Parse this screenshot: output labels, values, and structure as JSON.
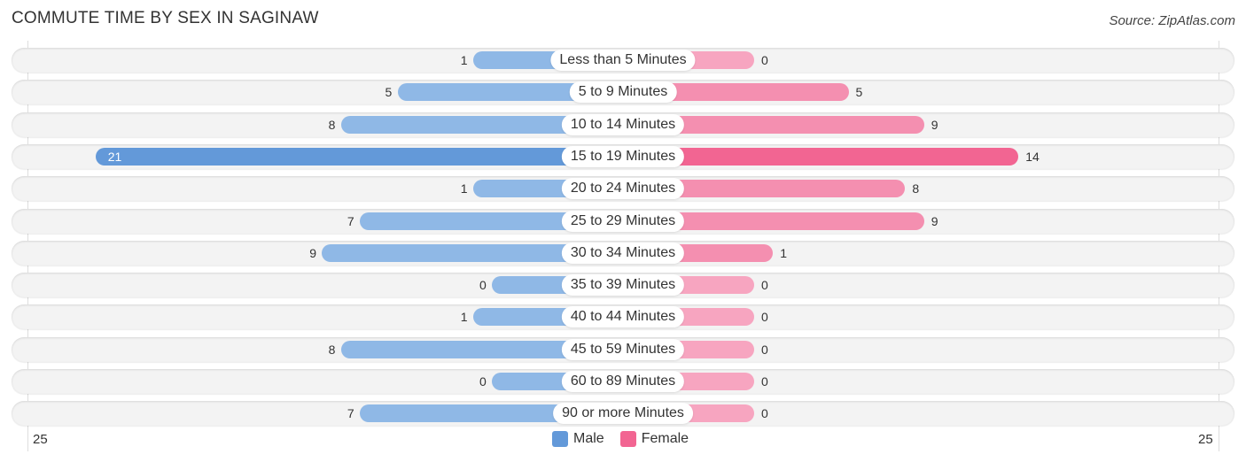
{
  "header": {
    "title": "COMMUTE TIME BY SEX IN SAGINAW",
    "source": "Source: ZipAtlas.com"
  },
  "colors": {
    "male": "#8fb8e6",
    "male_strong": "#6399d9",
    "female": "#f7a5c0",
    "female_strong": "#f26592"
  },
  "chart_data": {
    "type": "bar",
    "orientation": "horizontal-diverging",
    "title": "COMMUTE TIME BY SEX IN SAGINAW",
    "categories": [
      "Less than 5 Minutes",
      "5 to 9 Minutes",
      "10 to 14 Minutes",
      "15 to 19 Minutes",
      "20 to 24 Minutes",
      "25 to 29 Minutes",
      "30 to 34 Minutes",
      "35 to 39 Minutes",
      "40 to 44 Minutes",
      "45 to 59 Minutes",
      "60 to 89 Minutes",
      "90 or more Minutes"
    ],
    "series": [
      {
        "name": "Male",
        "values": [
          1,
          5,
          8,
          21,
          1,
          7,
          9,
          0,
          1,
          8,
          0,
          7
        ]
      },
      {
        "name": "Female",
        "values": [
          0,
          5,
          9,
          14,
          8,
          9,
          1,
          0,
          0,
          0,
          0,
          0
        ]
      }
    ],
    "axis": {
      "left_tick": "25",
      "right_tick": "25",
      "max": 25
    },
    "legend": {
      "position": "bottom-center",
      "entries": [
        "Male",
        "Female"
      ]
    }
  }
}
